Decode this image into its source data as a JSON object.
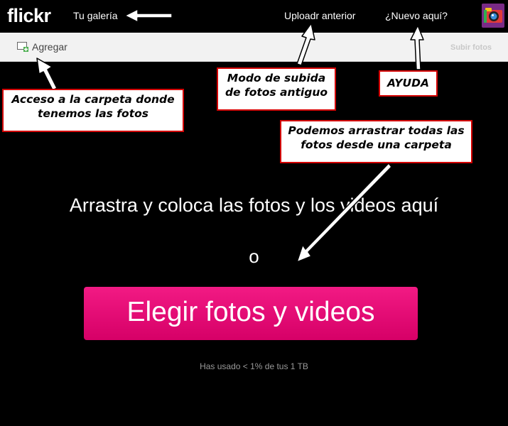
{
  "header": {
    "logo": "flickr",
    "gallery_link": "Tu galería",
    "old_uploader_link": "Uploadr anterior",
    "new_here_link": "¿Nuevo aquí?"
  },
  "toolbar": {
    "add_label": "Agregar",
    "upload_label": "Subir fotos"
  },
  "main": {
    "drop_text": "Arrastra y coloca las fotos y los videos aquí",
    "or_text": "o",
    "choose_button": "Elegir fotos y videos",
    "usage_text": "Has usado < 1% de tus 1 TB"
  },
  "annotations": {
    "folder_access": "Acceso a la carpeta donde tenemos las fotos",
    "old_upload_mode": "Modo de subida de fotos antiguo",
    "help": "AYUDA",
    "drag_folder": "Podemos arrastrar todas las fotos desde una carpeta"
  },
  "colors": {
    "background": "#000000",
    "toolbar_bg": "#f2f2f2",
    "button_pink": "#e8087a",
    "callout_border": "#d40000"
  },
  "icons": [
    "add-photo-icon",
    "camera-avatar-icon",
    "arrow-annotation"
  ]
}
